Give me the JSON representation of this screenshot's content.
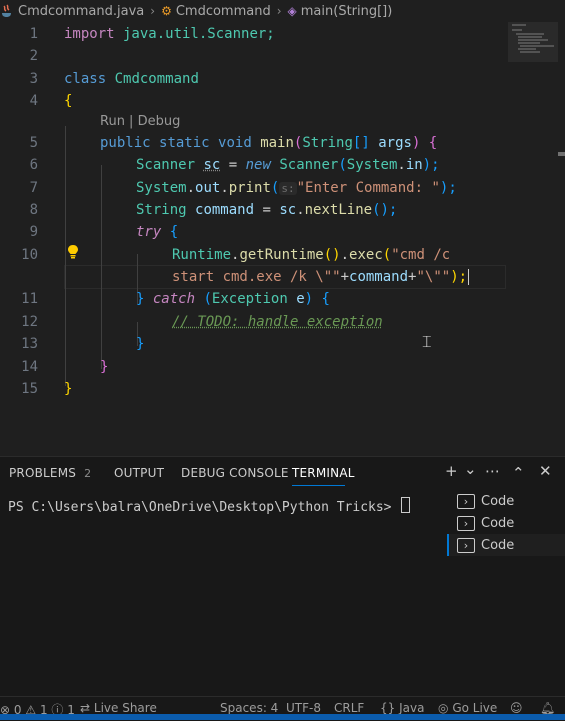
{
  "breadcrumb": {
    "file": "Cmdcommand.java",
    "class": "Cmdcommand",
    "method": "main(String[])"
  },
  "editor": {
    "line_numbers": [
      "1",
      "2",
      "3",
      "4",
      "5",
      "6",
      "7",
      "8",
      "9",
      "10",
      "",
      "11",
      "12",
      "13",
      "14",
      "15"
    ],
    "codelens": "Run | Debug",
    "lines": {
      "l1": {
        "import": "import",
        "pkg": " java.util.Scanner;"
      },
      "l3": {
        "class": "class",
        "name": "Cmdcommand"
      },
      "l4": {
        "brace": "{"
      },
      "l5": {
        "public": "public",
        "static": "static",
        "void": "void",
        "main": "main",
        "string": "String",
        "arr": "[]",
        "args": "args",
        "close": ") {"
      },
      "l6": {
        "type": "Scanner",
        "var": "sc",
        "eq": " = ",
        "new": "new",
        "type2": "Scanner",
        "system": "System",
        "in": "in",
        "end": ");"
      },
      "l7": {
        "system": "System",
        "out": "out",
        "print": "print",
        "hint": "s:",
        "str": "\"Enter Command: \"",
        "end": ");"
      },
      "l8": {
        "type": "String",
        "var": "command",
        "eq": " = ",
        "sc": "sc",
        "fn": "nextLine",
        "end": "();"
      },
      "l9": {
        "try": "try",
        "brace": "{"
      },
      "l10": {
        "runtime": "Runtime",
        "get": "getRuntime",
        "exec": "exec",
        "str": "\"cmd /c"
      },
      "l10b": {
        "str1": "start cmd.exe /k \\\"\"",
        "plus1": "+",
        "var": "command",
        "plus2": "+",
        "str2": "\"\\\"\"",
        "end": ");"
      },
      "l11": {
        "close": "}",
        "catch": "catch",
        "type": "Exception",
        "var": "e",
        "brace": "{"
      },
      "l12": {
        "comment": "// TODO: handle exception"
      },
      "l13": {
        "close": "}"
      },
      "l14": {
        "close": "}"
      },
      "l15": {
        "close": "}"
      }
    }
  },
  "panel": {
    "tabs": [
      {
        "label": "PROBLEMS",
        "badge": "2"
      },
      {
        "label": "OUTPUT"
      },
      {
        "label": "DEBUG CONSOLE"
      },
      {
        "label": "TERMINAL"
      }
    ],
    "actions": [
      "+",
      "⌄",
      "⋯",
      "⌃",
      "✕"
    ],
    "terminal_prompt": "PS C:\\Users\\balra\\OneDrive\\Desktop\\Python Tricks> ",
    "terminals": [
      "Code",
      "Code",
      "Code"
    ]
  },
  "statusbar": {
    "errors": "0",
    "warnings": "1",
    "info": "1",
    "live_share": "Live Share",
    "spaces": "Spaces: 4",
    "encoding": "UTF-8",
    "eol": "CRLF",
    "language": "Java",
    "go_live": "Go Live"
  },
  "colors": {
    "editor_bg": "#1f1f1f",
    "keyword": "#569cd6",
    "control": "#c586c0",
    "type": "#4ec9b0",
    "function": "#dcdcaa",
    "variable": "#9cdcfe",
    "string": "#ce9178",
    "comment": "#6a9955",
    "accent": "#0078d4"
  }
}
